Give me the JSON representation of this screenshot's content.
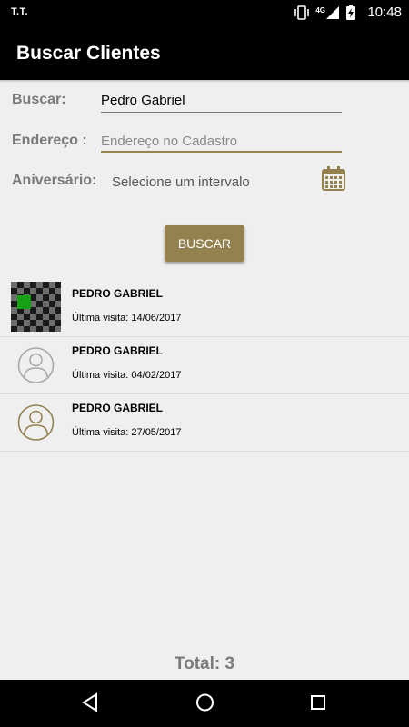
{
  "status": {
    "carrier": "T.T.",
    "network": "4G",
    "time": "10:48"
  },
  "appbar": {
    "title": "Buscar Clientes"
  },
  "form": {
    "buscar_label": "Buscar:",
    "buscar_value": "Pedro Gabriel",
    "endereco_label": "Endereço :",
    "endereco_placeholder": "Endereço no Cadastro",
    "aniversario_label": "Aniversário:",
    "aniversario_placeholder": "Selecione um intervalo",
    "button_label": "BUSCAR"
  },
  "clients": [
    {
      "name": "PEDRO GABRIEL",
      "visit": "Última visita: 14/06/2017",
      "avatar": "checkerboard-photo"
    },
    {
      "name": "PEDRO GABRIEL",
      "visit": "Última visita: 04/02/2017",
      "avatar": "person-icon-gray"
    },
    {
      "name": "PEDRO GABRIEL",
      "visit": "Última visita: 27/05/2017",
      "avatar": "person-icon-gold"
    }
  ],
  "footer": {
    "total": "Total: 3"
  },
  "colors": {
    "accent": "#93824f",
    "label": "#7a7a7a",
    "bar": "#000000"
  }
}
